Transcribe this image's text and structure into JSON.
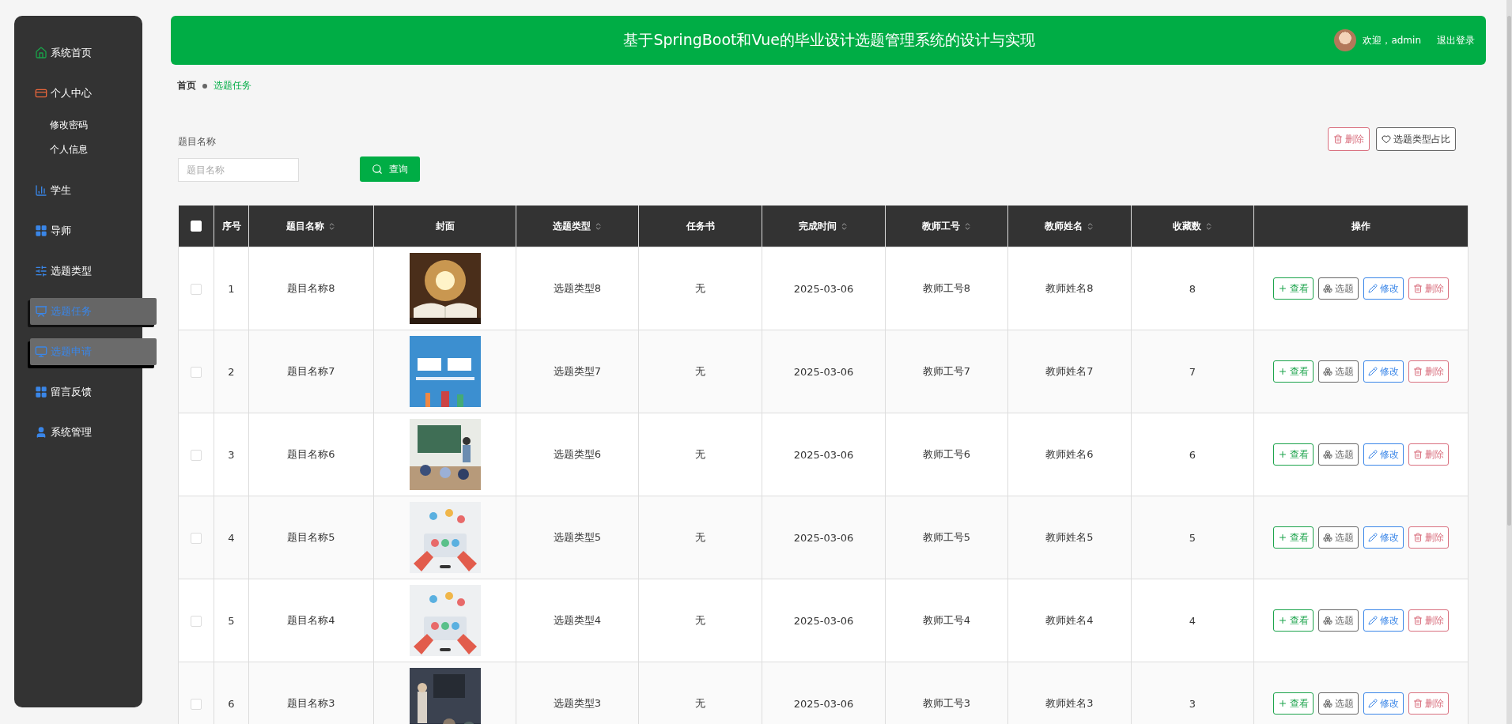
{
  "sidebar": {
    "items": [
      {
        "label": "系统首页",
        "selected": false,
        "hovered": false
      },
      {
        "label": "个人中心",
        "selected": false,
        "hovered": false,
        "children": [
          {
            "label": "修改密码"
          },
          {
            "label": "个人信息"
          }
        ]
      },
      {
        "label": "学生",
        "selected": false,
        "hovered": false
      },
      {
        "label": "导师",
        "selected": false,
        "hovered": false
      },
      {
        "label": "选题类型",
        "selected": false,
        "hovered": false
      },
      {
        "label": "选题任务",
        "selected": true,
        "hovered": false
      },
      {
        "label": "选题申请",
        "selected": false,
        "hovered": true
      },
      {
        "label": "留言反馈",
        "selected": false,
        "hovered": false
      },
      {
        "label": "系统管理",
        "selected": false,
        "hovered": false
      }
    ]
  },
  "header": {
    "title": "基于SpringBoot和Vue的毕业设计选题管理系统的设计与实现",
    "welcome": "欢迎，admin",
    "logout": "退出登录"
  },
  "breadcrumb": [
    "首页",
    "选题任务"
  ],
  "search": {
    "label": "题目名称",
    "placeholder": "题目名称",
    "button": "查询"
  },
  "actions": [
    "删除",
    "选题类型占比"
  ],
  "table": {
    "select_all": {
      "checked": false
    },
    "columns": [
      {
        "label": "序号",
        "sortable": false
      },
      {
        "label": "题目名称",
        "sortable": true
      },
      {
        "label": "封面",
        "sortable": false
      },
      {
        "label": "选题类型",
        "sortable": true
      },
      {
        "label": "任务书",
        "sortable": false
      },
      {
        "label": "完成时间",
        "sortable": true
      },
      {
        "label": "教师工号",
        "sortable": true
      },
      {
        "label": "教师姓名",
        "sortable": true
      },
      {
        "label": "收藏数",
        "sortable": true
      },
      {
        "label": "操作",
        "sortable": false
      }
    ],
    "rows": [
      {
        "checked": false,
        "cells": [
          "1",
          "题目名称8",
          {
            "kind": "picture"
          },
          "选题类型8",
          "无",
          "2025-03-06",
          "教师工号8",
          "教师姓名8",
          "8"
        ],
        "buttons": [
          "查看",
          "选题",
          "修改",
          "删除"
        ]
      },
      {
        "checked": false,
        "cells": [
          "2",
          "题目名称7",
          {
            "kind": "picture"
          },
          "选题类型7",
          "无",
          "2025-03-06",
          "教师工号7",
          "教师姓名7",
          "7"
        ],
        "buttons": [
          "查看",
          "选题",
          "修改",
          "删除"
        ]
      },
      {
        "checked": false,
        "cells": [
          "3",
          "题目名称6",
          {
            "kind": "picture"
          },
          "选题类型6",
          "无",
          "2025-03-06",
          "教师工号6",
          "教师姓名6",
          "6"
        ],
        "buttons": [
          "查看",
          "选题",
          "修改",
          "删除"
        ]
      },
      {
        "checked": false,
        "cells": [
          "4",
          "题目名称5",
          {
            "kind": "picture"
          },
          "选题类型5",
          "无",
          "2025-03-06",
          "教师工号5",
          "教师姓名5",
          "5"
        ],
        "buttons": [
          "查看",
          "选题",
          "修改",
          "删除"
        ]
      },
      {
        "checked": false,
        "cells": [
          "5",
          "题目名称4",
          {
            "kind": "picture"
          },
          "选题类型4",
          "无",
          "2025-03-06",
          "教师工号4",
          "教师姓名4",
          "4"
        ],
        "buttons": [
          "查看",
          "选题",
          "修改",
          "删除"
        ]
      },
      {
        "checked": false,
        "cells": [
          "6",
          "题目名称3",
          {
            "kind": "picture"
          },
          "选题类型3",
          "无",
          "2025-03-06",
          "教师工号3",
          "教师姓名3",
          "3"
        ],
        "buttons": [
          "查看",
          "选题",
          "修改",
          "删除"
        ]
      }
    ]
  }
}
